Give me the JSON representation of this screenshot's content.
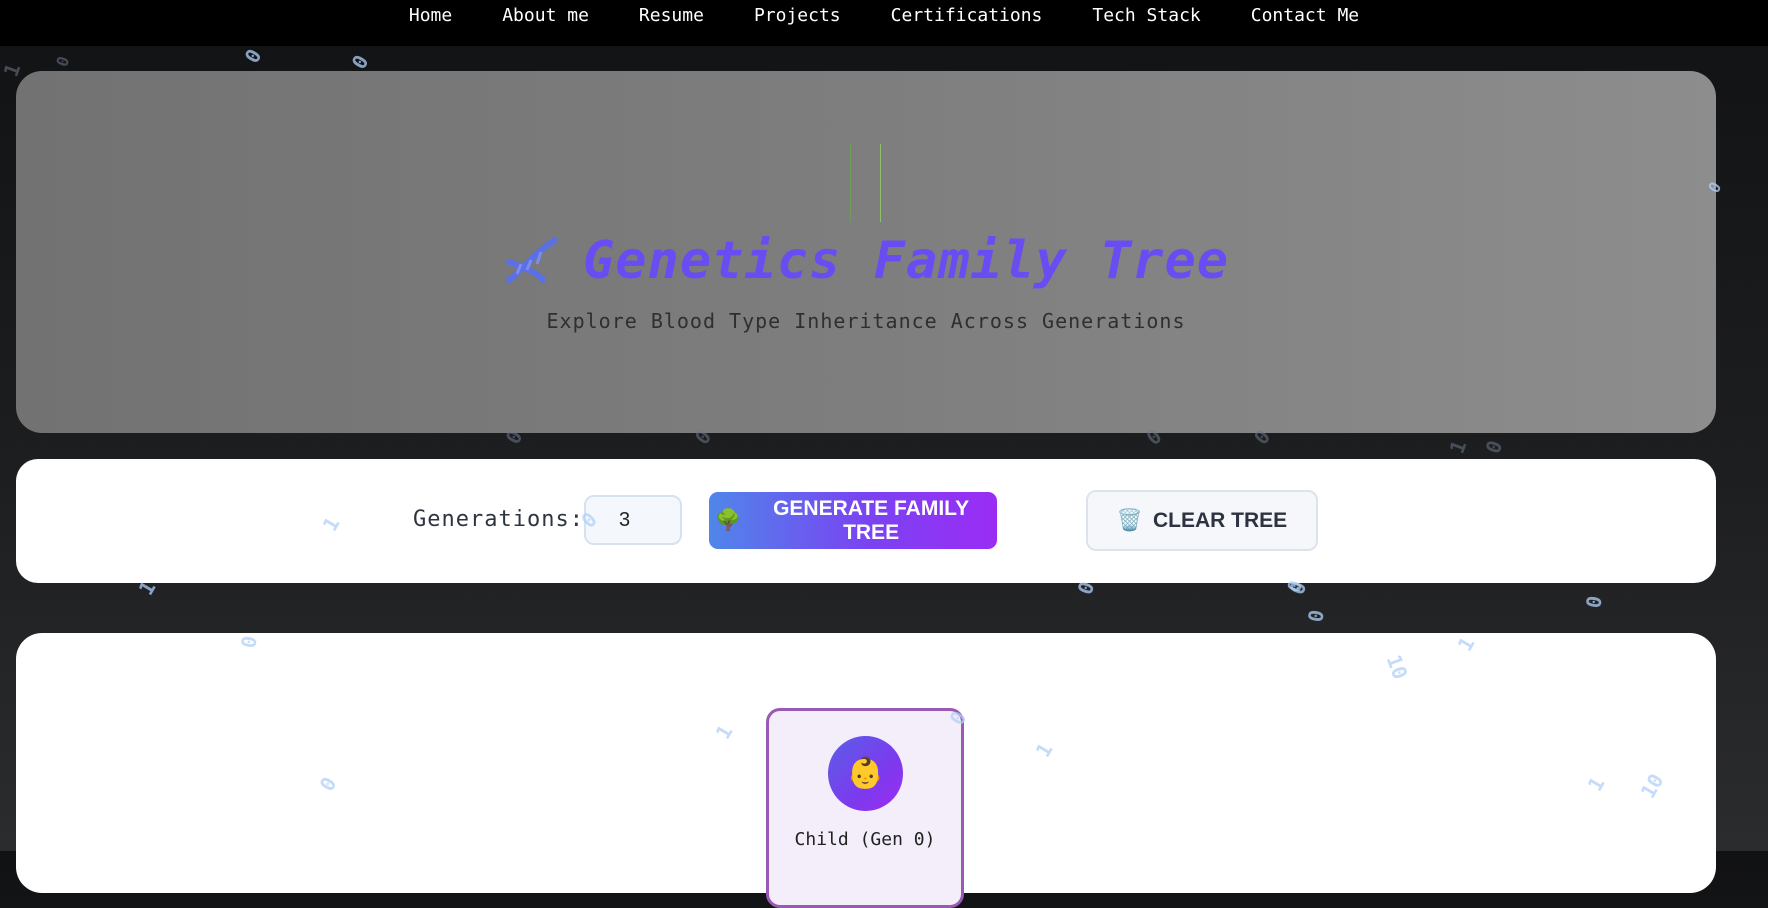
{
  "nav": {
    "items": [
      "Home",
      "About me",
      "Resume",
      "Projects",
      "Certifications",
      "Tech Stack",
      "Contact Me"
    ]
  },
  "hero": {
    "title": "Genetics Family Tree",
    "subtitle": "Explore Blood Type Inheritance Across Generations",
    "icon": "dna-icon",
    "title_color": "#6a4df2"
  },
  "controls": {
    "generations_label": "Generations:",
    "generations_value": "3",
    "generate_icon": "🌳",
    "generate_label": "GENERATE FAMILY TREE",
    "clear_icon": "🗑️",
    "clear_label": "CLEAR TREE"
  },
  "tree": {
    "nodes": [
      {
        "name": "Child (Gen 0)",
        "avatar": "👶"
      }
    ]
  },
  "background_bits": [
    "1",
    "0",
    "0",
    "0",
    "0",
    "0",
    "0",
    "0",
    "0",
    "1",
    "0",
    "1",
    "0",
    "1",
    "0",
    "0",
    "0",
    "0",
    "0",
    "10",
    "1",
    "1",
    "0",
    "1",
    "0",
    "1",
    "10",
    "0",
    "1",
    "0"
  ],
  "colors": {
    "nav_bg": "#000000",
    "accent_gradient_start": "#4f86ea",
    "accent_gradient_end": "#9b2cf4",
    "card_border": "#9b59b6"
  }
}
